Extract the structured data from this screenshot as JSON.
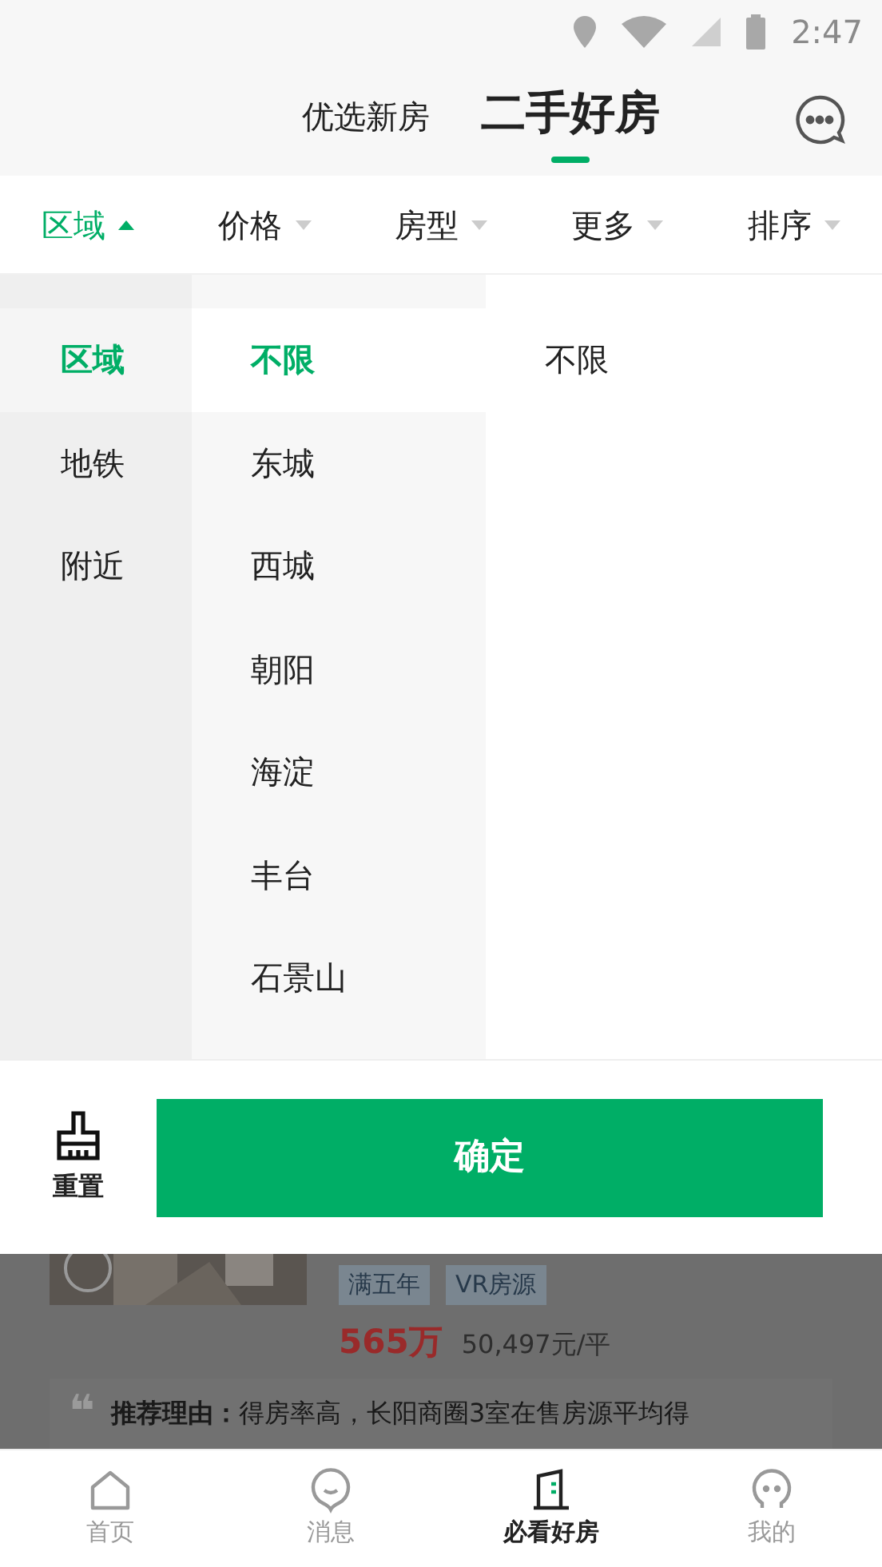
{
  "status_bar": {
    "time": "2:47"
  },
  "header_tabs": [
    {
      "label": "优选新房",
      "selected": false
    },
    {
      "label": "二手好房",
      "selected": true
    }
  ],
  "filter_tabs": [
    {
      "label": "区域",
      "selected": true
    },
    {
      "label": "价格",
      "selected": false
    },
    {
      "label": "房型",
      "selected": false
    },
    {
      "label": "更多",
      "selected": false
    },
    {
      "label": "排序",
      "selected": false
    }
  ],
  "categories": [
    {
      "label": "区域",
      "selected": true
    },
    {
      "label": "地铁",
      "selected": false
    },
    {
      "label": "附近",
      "selected": false
    }
  ],
  "districts": [
    {
      "label": "不限",
      "selected": true
    },
    {
      "label": "东城",
      "selected": false
    },
    {
      "label": "西城",
      "selected": false
    },
    {
      "label": "朝阳",
      "selected": false
    },
    {
      "label": "海淀",
      "selected": false
    },
    {
      "label": "丰台",
      "selected": false
    },
    {
      "label": "石景山",
      "selected": false
    }
  ],
  "sub_options": [
    {
      "label": "不限"
    }
  ],
  "actions": {
    "reset": "重置",
    "confirm": "确定"
  },
  "listing": {
    "quote_mark": "❝",
    "tags": [
      "满五年",
      "VR房源"
    ],
    "price": "565万",
    "unit_price": "50,497元/平",
    "reason": "**推荐理由：**得房率高，长阳商圈3室在售房源平均得"
  },
  "bottom_nav": [
    {
      "label": "首页",
      "selected": false
    },
    {
      "label": "消息",
      "selected": false
    },
    {
      "label": "必看好房",
      "selected": true
    },
    {
      "label": "我的",
      "selected": false
    }
  ]
}
